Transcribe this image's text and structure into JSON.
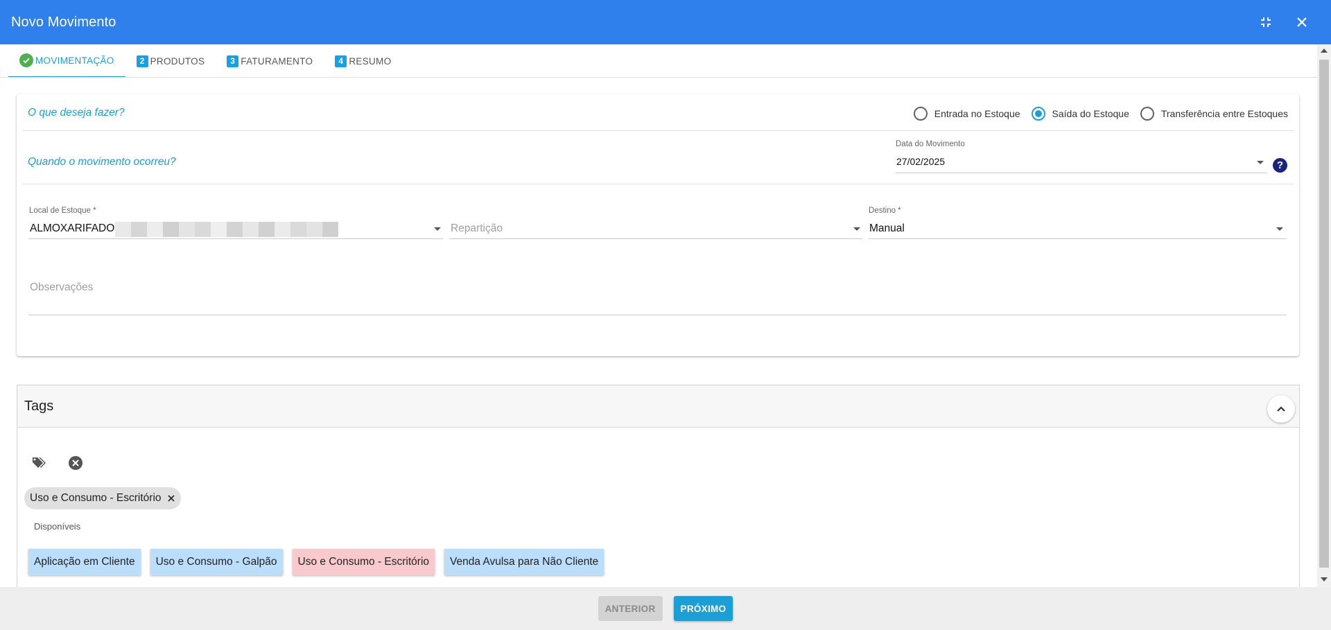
{
  "header": {
    "title": "Novo Movimento",
    "minimize_icon": "minimize-icon",
    "close_icon": "close-icon"
  },
  "tabs": [
    {
      "label": "MOVIMENTAÇÃO",
      "marker": "check",
      "active": true
    },
    {
      "label": "PRODUTOS",
      "marker": "2"
    },
    {
      "label": "FATURAMENTO",
      "marker": "3"
    },
    {
      "label": "RESUMO",
      "marker": "4"
    }
  ],
  "form": {
    "question_action": "O que deseja fazer?",
    "radio_options": [
      {
        "label": "Entrada no Estoque",
        "selected": false
      },
      {
        "label": "Saída do Estoque",
        "selected": true
      },
      {
        "label": "Transferência entre Estoques",
        "selected": false
      }
    ],
    "question_when": "Quando o movimento ocorreu?",
    "date_label": "Data do Movimento",
    "date_value": "27/02/2025",
    "local_label": "Local de Estoque *",
    "local_value": "ALMOXARIFADO |",
    "reparticao_placeholder": "Repartição",
    "destino_label": "Destino *",
    "destino_value": "Manual",
    "observacoes_placeholder": "Observações"
  },
  "tags": {
    "title": "Tags",
    "selected": [
      {
        "label": "Uso e Consumo - Escritório"
      }
    ],
    "available_label": "Disponíveis",
    "available": [
      {
        "label": "Aplicação em Cliente",
        "color": "#bbdefb"
      },
      {
        "label": "Uso e Consumo - Galpão",
        "color": "#bbdefb"
      },
      {
        "label": "Uso e Consumo - Escritório",
        "color": "#f8c9cd"
      },
      {
        "label": "Venda Avulsa para Não Cliente",
        "color": "#bbdefb"
      }
    ]
  },
  "footer": {
    "prev_label": "ANTERIOR",
    "next_label": "PRÓXIMO"
  },
  "colors": {
    "header": "#2f80ed",
    "accent": "#1a9fd6",
    "success": "#4caf50",
    "help": "#1a237e"
  }
}
